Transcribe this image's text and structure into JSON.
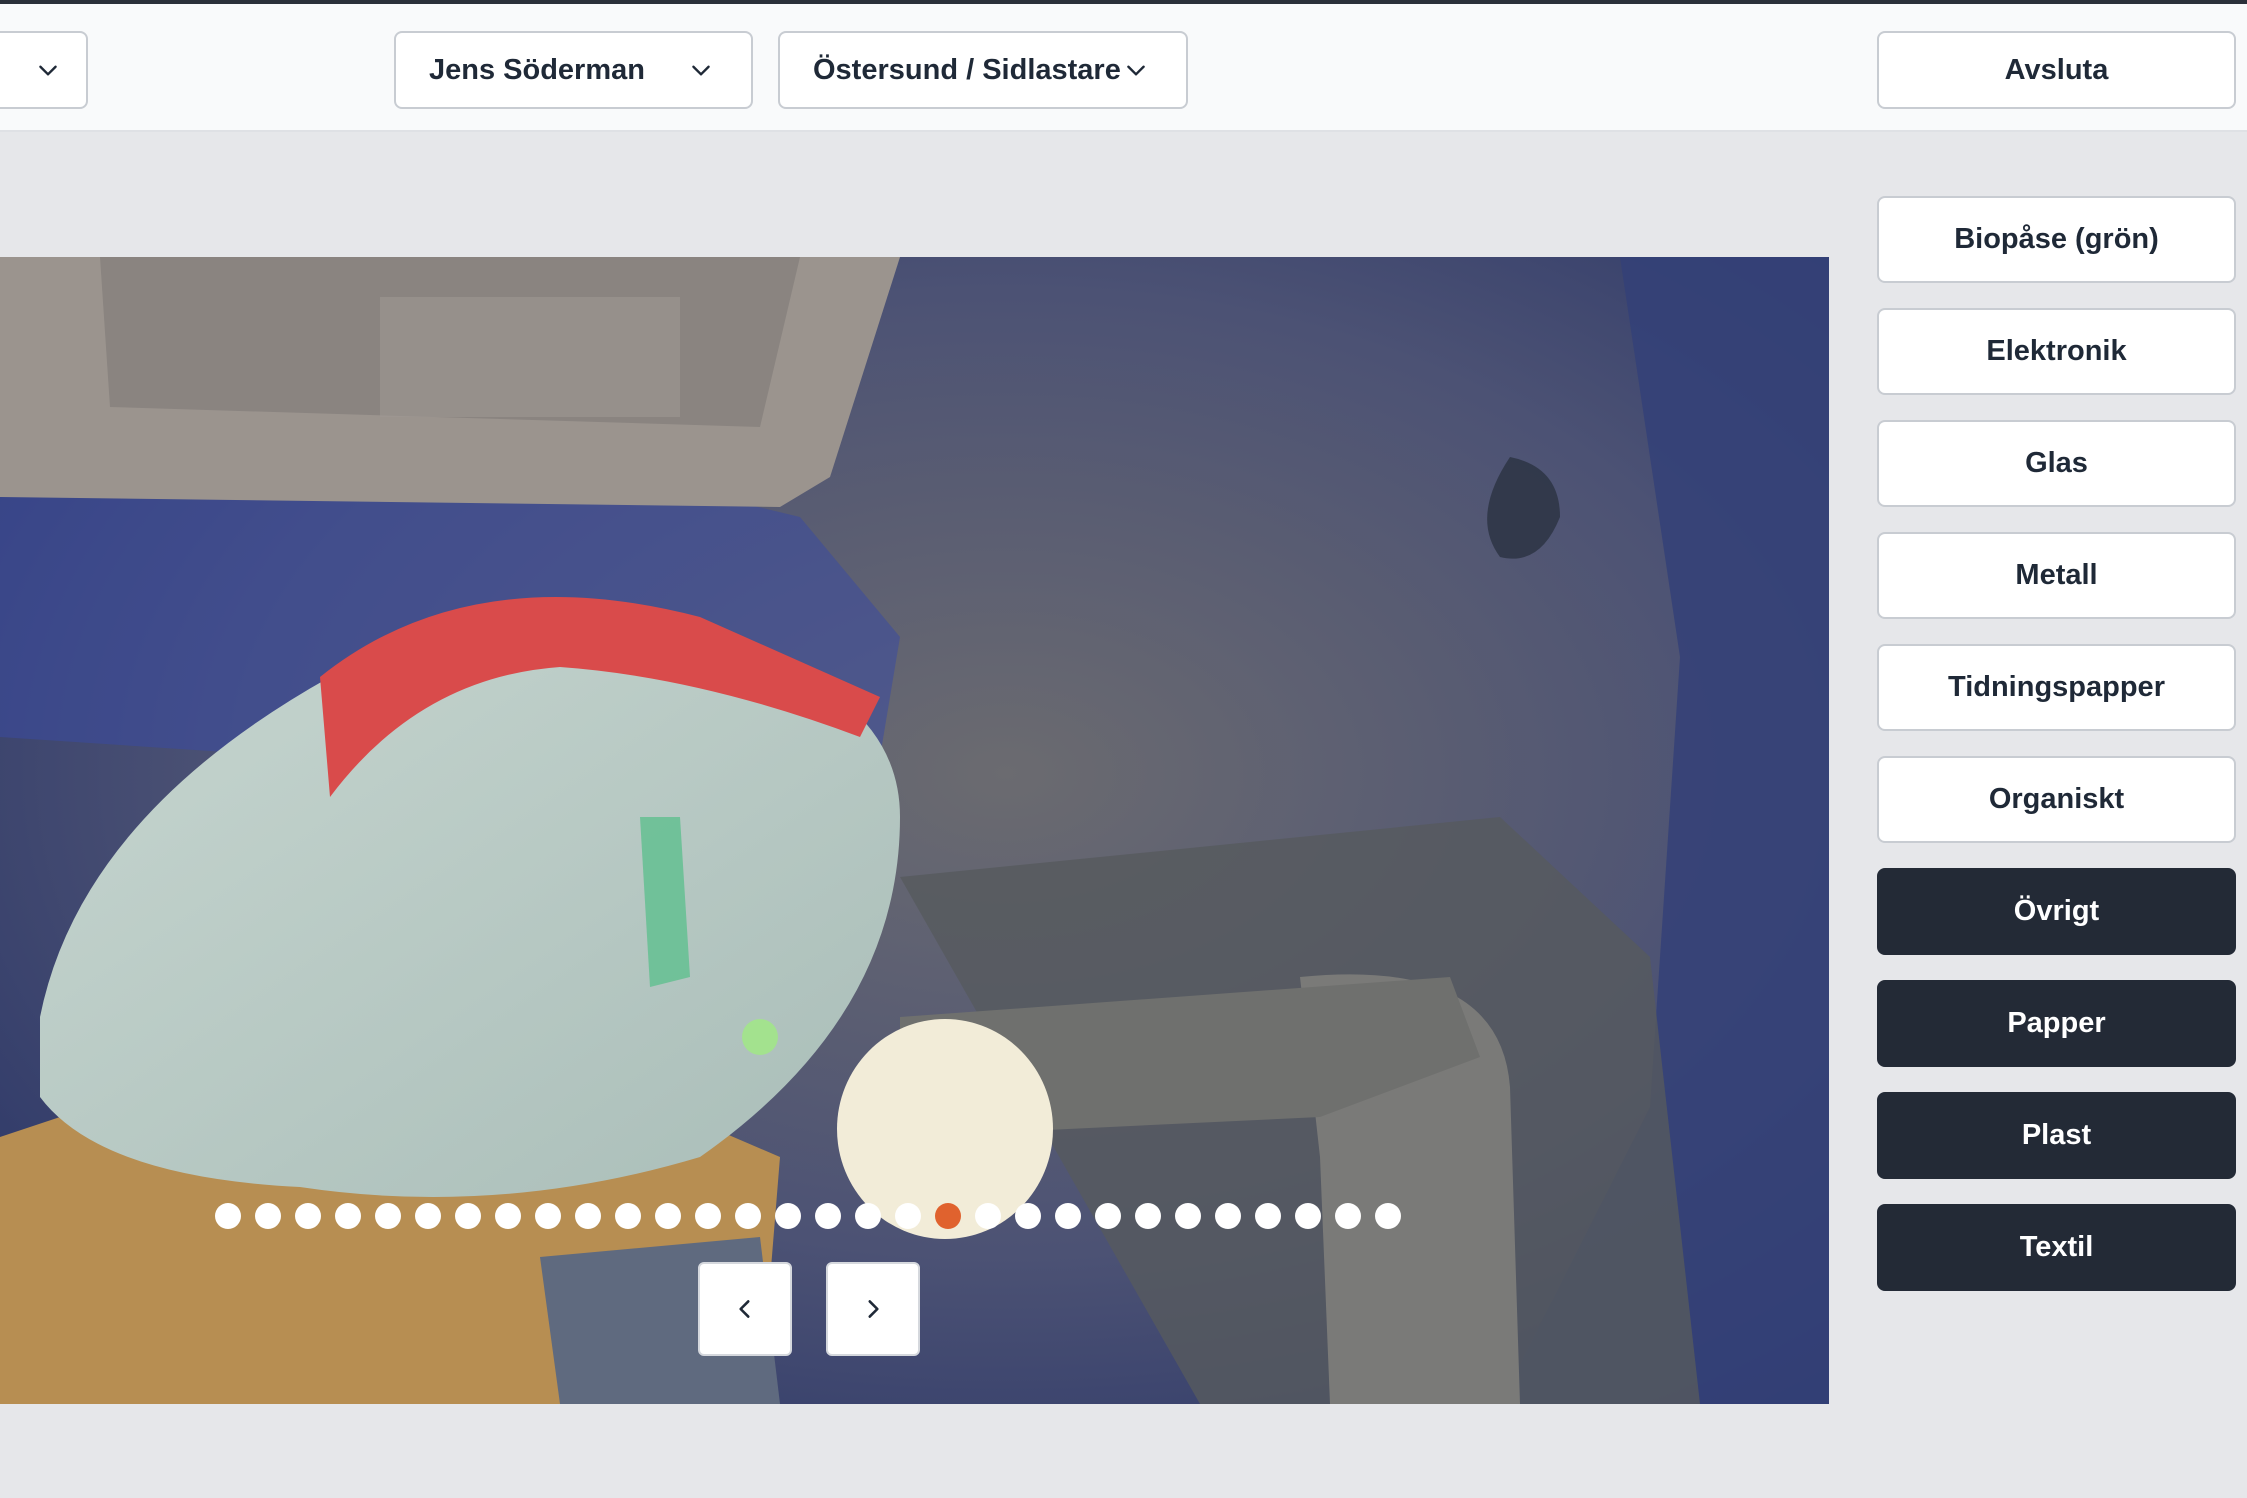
{
  "header": {
    "left_select_value": "",
    "person_select": "Jens Söderman",
    "site_select": "Östersund / Sidlastare",
    "exit_button": "Avsluta"
  },
  "icons": {
    "dropdown": "chevron-down-icon",
    "previous": "chevron-left-icon",
    "next": "chevron-right-icon"
  },
  "carousel": {
    "total_images": 30,
    "active_index": 18
  },
  "categories": [
    {
      "label": "Biopåse (grön)",
      "style": "light"
    },
    {
      "label": "Elektronik",
      "style": "light"
    },
    {
      "label": "Glas",
      "style": "light"
    },
    {
      "label": "Metall",
      "style": "light"
    },
    {
      "label": "Tidningspapper",
      "style": "light"
    },
    {
      "label": "Organiskt",
      "style": "light"
    },
    {
      "label": "Övrigt",
      "style": "dark"
    },
    {
      "label": "Papper",
      "style": "dark"
    },
    {
      "label": "Plast",
      "style": "dark"
    },
    {
      "label": "Textil",
      "style": "dark"
    }
  ],
  "colors": {
    "active_dot": "#e0622e",
    "dark_button": "#232a36",
    "page_background": "#e6e7ea"
  }
}
